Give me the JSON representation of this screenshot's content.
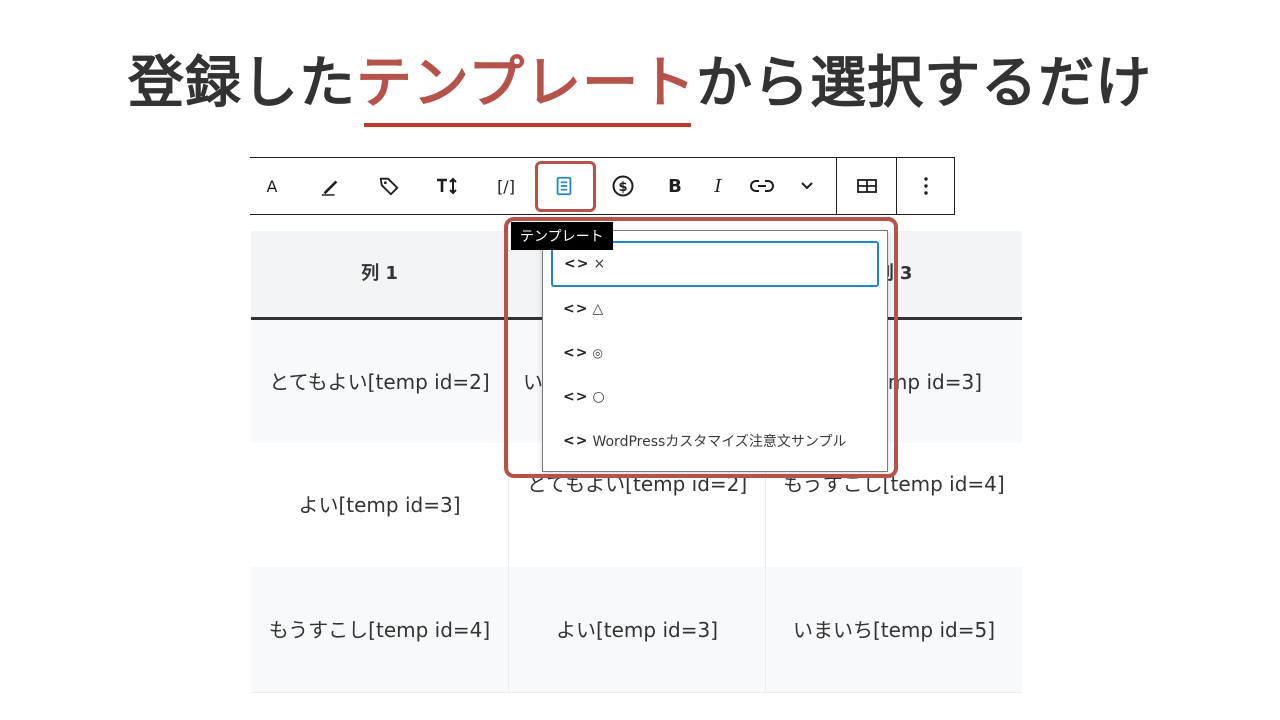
{
  "headline": {
    "prefix": "登録した",
    "accent": "テンプレート",
    "suffix": "から選択するだけ"
  },
  "toolbar": {
    "text_a": "A",
    "shortcode": "[/]",
    "bold": "B",
    "italic": "I"
  },
  "tooltip": {
    "label": "テンプレート"
  },
  "dropdown": {
    "items": [
      {
        "label": "×"
      },
      {
        "label": "△"
      },
      {
        "label": "◎"
      },
      {
        "label": "○"
      },
      {
        "label": "WordPressカスタマイズ注意文サンプル"
      }
    ]
  },
  "table": {
    "headers": [
      "列 1",
      "",
      "列 3"
    ],
    "rows": [
      [
        "とてもよい[temp id=2]",
        "い",
        "mp id=3]"
      ],
      [
        "よい[temp id=3]",
        "とてもよい[temp id=2]",
        "もうすこし[temp id=4]"
      ],
      [
        "もうすこし[temp id=4]",
        "よい[temp id=3]",
        "いまいち[temp id=5]"
      ]
    ]
  },
  "colors": {
    "accent": "#b5534a",
    "underline": "#c0392b",
    "focus": "#1e88c7"
  }
}
